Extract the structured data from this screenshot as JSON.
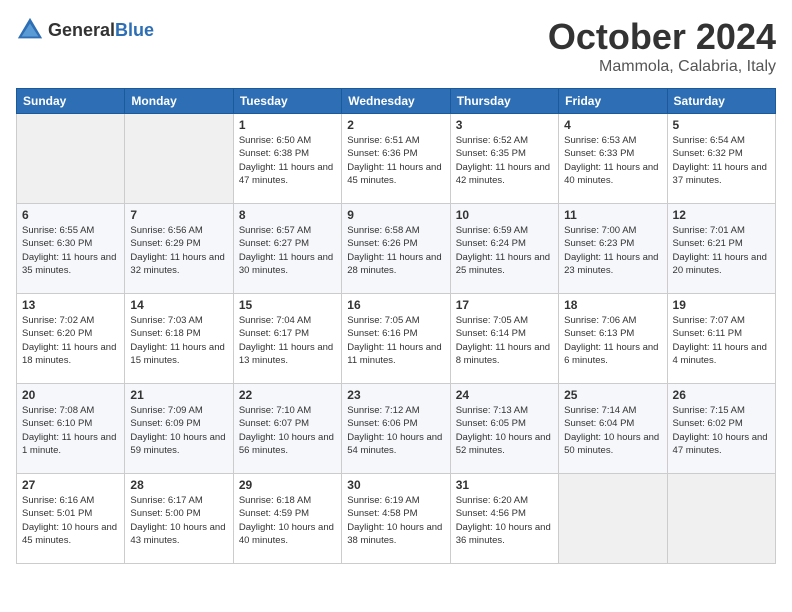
{
  "logo": {
    "text_general": "General",
    "text_blue": "Blue"
  },
  "title": {
    "month": "October 2024",
    "location": "Mammola, Calabria, Italy"
  },
  "weekdays": [
    "Sunday",
    "Monday",
    "Tuesday",
    "Wednesday",
    "Thursday",
    "Friday",
    "Saturday"
  ],
  "weeks": [
    [
      {
        "day": "",
        "info": ""
      },
      {
        "day": "",
        "info": ""
      },
      {
        "day": "1",
        "info": "Sunrise: 6:50 AM\nSunset: 6:38 PM\nDaylight: 11 hours and 47 minutes."
      },
      {
        "day": "2",
        "info": "Sunrise: 6:51 AM\nSunset: 6:36 PM\nDaylight: 11 hours and 45 minutes."
      },
      {
        "day": "3",
        "info": "Sunrise: 6:52 AM\nSunset: 6:35 PM\nDaylight: 11 hours and 42 minutes."
      },
      {
        "day": "4",
        "info": "Sunrise: 6:53 AM\nSunset: 6:33 PM\nDaylight: 11 hours and 40 minutes."
      },
      {
        "day": "5",
        "info": "Sunrise: 6:54 AM\nSunset: 6:32 PM\nDaylight: 11 hours and 37 minutes."
      }
    ],
    [
      {
        "day": "6",
        "info": "Sunrise: 6:55 AM\nSunset: 6:30 PM\nDaylight: 11 hours and 35 minutes."
      },
      {
        "day": "7",
        "info": "Sunrise: 6:56 AM\nSunset: 6:29 PM\nDaylight: 11 hours and 32 minutes."
      },
      {
        "day": "8",
        "info": "Sunrise: 6:57 AM\nSunset: 6:27 PM\nDaylight: 11 hours and 30 minutes."
      },
      {
        "day": "9",
        "info": "Sunrise: 6:58 AM\nSunset: 6:26 PM\nDaylight: 11 hours and 28 minutes."
      },
      {
        "day": "10",
        "info": "Sunrise: 6:59 AM\nSunset: 6:24 PM\nDaylight: 11 hours and 25 minutes."
      },
      {
        "day": "11",
        "info": "Sunrise: 7:00 AM\nSunset: 6:23 PM\nDaylight: 11 hours and 23 minutes."
      },
      {
        "day": "12",
        "info": "Sunrise: 7:01 AM\nSunset: 6:21 PM\nDaylight: 11 hours and 20 minutes."
      }
    ],
    [
      {
        "day": "13",
        "info": "Sunrise: 7:02 AM\nSunset: 6:20 PM\nDaylight: 11 hours and 18 minutes."
      },
      {
        "day": "14",
        "info": "Sunrise: 7:03 AM\nSunset: 6:18 PM\nDaylight: 11 hours and 15 minutes."
      },
      {
        "day": "15",
        "info": "Sunrise: 7:04 AM\nSunset: 6:17 PM\nDaylight: 11 hours and 13 minutes."
      },
      {
        "day": "16",
        "info": "Sunrise: 7:05 AM\nSunset: 6:16 PM\nDaylight: 11 hours and 11 minutes."
      },
      {
        "day": "17",
        "info": "Sunrise: 7:05 AM\nSunset: 6:14 PM\nDaylight: 11 hours and 8 minutes."
      },
      {
        "day": "18",
        "info": "Sunrise: 7:06 AM\nSunset: 6:13 PM\nDaylight: 11 hours and 6 minutes."
      },
      {
        "day": "19",
        "info": "Sunrise: 7:07 AM\nSunset: 6:11 PM\nDaylight: 11 hours and 4 minutes."
      }
    ],
    [
      {
        "day": "20",
        "info": "Sunrise: 7:08 AM\nSunset: 6:10 PM\nDaylight: 11 hours and 1 minute."
      },
      {
        "day": "21",
        "info": "Sunrise: 7:09 AM\nSunset: 6:09 PM\nDaylight: 10 hours and 59 minutes."
      },
      {
        "day": "22",
        "info": "Sunrise: 7:10 AM\nSunset: 6:07 PM\nDaylight: 10 hours and 56 minutes."
      },
      {
        "day": "23",
        "info": "Sunrise: 7:12 AM\nSunset: 6:06 PM\nDaylight: 10 hours and 54 minutes."
      },
      {
        "day": "24",
        "info": "Sunrise: 7:13 AM\nSunset: 6:05 PM\nDaylight: 10 hours and 52 minutes."
      },
      {
        "day": "25",
        "info": "Sunrise: 7:14 AM\nSunset: 6:04 PM\nDaylight: 10 hours and 50 minutes."
      },
      {
        "day": "26",
        "info": "Sunrise: 7:15 AM\nSunset: 6:02 PM\nDaylight: 10 hours and 47 minutes."
      }
    ],
    [
      {
        "day": "27",
        "info": "Sunrise: 6:16 AM\nSunset: 5:01 PM\nDaylight: 10 hours and 45 minutes."
      },
      {
        "day": "28",
        "info": "Sunrise: 6:17 AM\nSunset: 5:00 PM\nDaylight: 10 hours and 43 minutes."
      },
      {
        "day": "29",
        "info": "Sunrise: 6:18 AM\nSunset: 4:59 PM\nDaylight: 10 hours and 40 minutes."
      },
      {
        "day": "30",
        "info": "Sunrise: 6:19 AM\nSunset: 4:58 PM\nDaylight: 10 hours and 38 minutes."
      },
      {
        "day": "31",
        "info": "Sunrise: 6:20 AM\nSunset: 4:56 PM\nDaylight: 10 hours and 36 minutes."
      },
      {
        "day": "",
        "info": ""
      },
      {
        "day": "",
        "info": ""
      }
    ]
  ]
}
